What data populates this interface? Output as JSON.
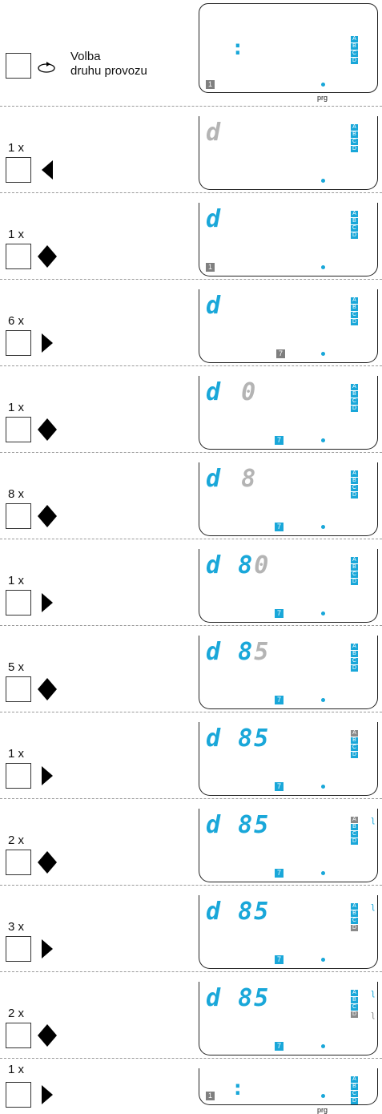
{
  "mode_label": {
    "line1": "Volba",
    "line2": "druhu provozu"
  },
  "prg_label": "prg",
  "abcd": [
    "A",
    "B",
    "C",
    "D"
  ],
  "steps": [
    {
      "count": "",
      "arrow": "clock-icon",
      "digits_on": "",
      "digits_off": "",
      "day": "1",
      "day_color": "grey"
    },
    {
      "count": "1 x",
      "arrow": "arrow-left-icon",
      "digits_on": "",
      "digits_off": "d",
      "day": "",
      "day_color": ""
    },
    {
      "count": "1 x",
      "arrow": "diamond-icon",
      "digits_on": "d",
      "digits_off": "",
      "day": "1",
      "day_color": "grey"
    },
    {
      "count": "6 x",
      "arrow": "arrow-right-icon",
      "digits_on": "d",
      "digits_off": "",
      "day": "7",
      "day_color": "grey"
    },
    {
      "count": "1 x",
      "arrow": "diamond-icon",
      "digits_on": "d",
      "digits_off": "0",
      "day": "7",
      "day_color": "blue"
    },
    {
      "count": "8 x",
      "arrow": "diamond-icon",
      "digits_on": "d",
      "digits_off": "8",
      "day": "7",
      "day_color": "blue"
    },
    {
      "count": "1 x",
      "arrow": "arrow-right-icon",
      "digits_on": "d 8",
      "digits_off": "0",
      "day": "7",
      "day_color": "blue"
    },
    {
      "count": "5 x",
      "arrow": "diamond-icon",
      "digits_on": "d 8",
      "digits_off": "5",
      "day": "7",
      "day_color": "blue"
    },
    {
      "count": "1 x",
      "arrow": "arrow-right-icon",
      "digits_on": "d 85",
      "digits_off": "",
      "day": "7",
      "day_color": "blue"
    },
    {
      "count": "2 x",
      "arrow": "diamond-icon",
      "digits_on": "d 85",
      "digits_off": "",
      "day": "7",
      "day_color": "blue"
    },
    {
      "count": "3 x",
      "arrow": "arrow-right-icon",
      "digits_on": "d 85",
      "digits_off": "",
      "day": "7",
      "day_color": "blue"
    },
    {
      "count": "2 x",
      "arrow": "diamond-icon",
      "digits_on": "d 85",
      "digits_off": "",
      "day": "7",
      "day_color": "blue"
    },
    {
      "count": "1 x",
      "arrow": "arrow-right-icon",
      "digits_on": "",
      "digits_off": "",
      "day": "1",
      "day_color": "grey"
    }
  ],
  "colors": {
    "segment_on": "#19a7d9",
    "segment_off": "#b4b4b4",
    "block_grey": "#7f7f7f"
  }
}
